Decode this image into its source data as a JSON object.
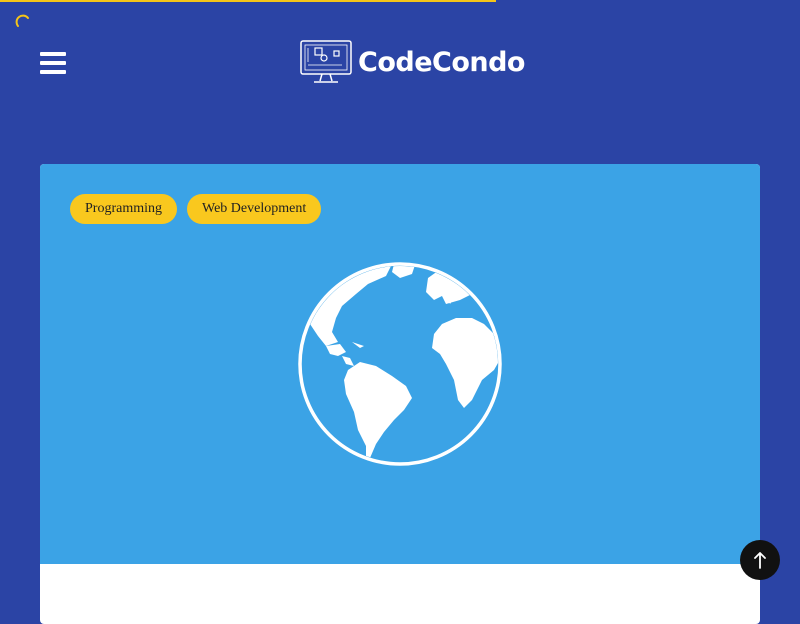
{
  "loading": {
    "progress": 0.62,
    "bar_color": "#f5c518"
  },
  "header": {
    "logo_text": "CodeCondo",
    "menu_icon": "hamburger-menu-icon",
    "background": "#2b44a5"
  },
  "post": {
    "tags": [
      {
        "label": "Programming"
      },
      {
        "label": "Web Development"
      }
    ],
    "hero_icon": "globe-icon",
    "hero_color": "#3ba3e6",
    "tag_color": "#f9c81e"
  },
  "back_to_top": {
    "icon": "arrow-up-icon"
  }
}
